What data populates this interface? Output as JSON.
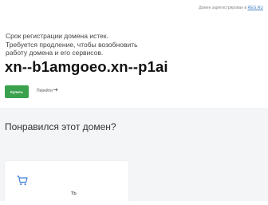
{
  "header": {
    "registrar_note_prefix": "Домен зарегистрирован в",
    "registrar_link": "REG.RU"
  },
  "main": {
    "expired_lines": [
      "Срок регистрации домена истек.",
      "Требуется продление, чтобы возобновить",
      "работу домена и его сервисов."
    ],
    "domain_name": "xn--b1amgoeo.xn--p1ai",
    "renew_button_label": "Купить",
    "goto_link_label": "Перейти",
    "accent_color": "#3aa14d"
  },
  "offer": {
    "heading": "Понравился этот домен?",
    "card_text_fragment": "ть",
    "cart_icon_color": "#3f7fd6"
  }
}
